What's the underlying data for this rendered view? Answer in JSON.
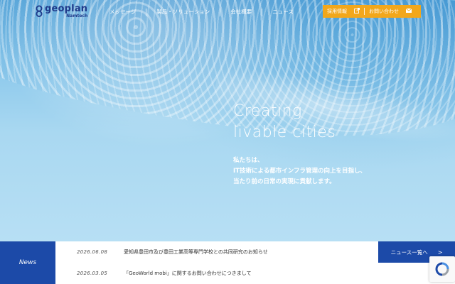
{
  "brand": {
    "name": "geoplan",
    "sub": "Namtech"
  },
  "nav": {
    "items": [
      {
        "label": "メッセージ"
      },
      {
        "label": "製品・ソリューション"
      },
      {
        "label": "会社概要"
      },
      {
        "label": "ニュース"
      }
    ]
  },
  "cta": {
    "recruit": "採用情報",
    "contact": "お問い合わせ"
  },
  "hero": {
    "headline_line1": "Creating",
    "headline_line2": "livable cities",
    "tagline_line1": "私たちは、",
    "tagline_line2": "IT技術による都市インフラ管理の向上を目指し、",
    "tagline_line3": "当たり前の日常の実現に貢献します。"
  },
  "news": {
    "label": "News",
    "items": [
      {
        "date": "2026.06.08",
        "title": "愛知県豊田市及び豊田工業高等専門学校との共同研究のお知らせ"
      },
      {
        "date": "2026.03.05",
        "title": "「GeoWorld mobi」に関するお問い合わせにつきまして"
      }
    ],
    "all_label": "ニュース一覧へ",
    "all_arrow": ">"
  },
  "colors": {
    "brand_blue": "#1c4aa8",
    "cta_orange": "#f2a71b"
  }
}
